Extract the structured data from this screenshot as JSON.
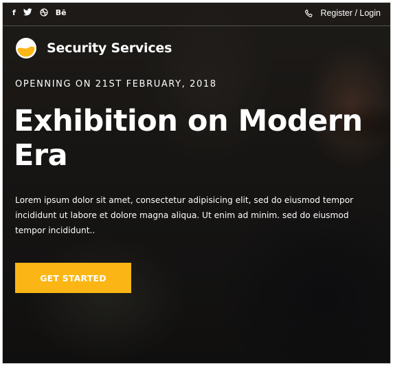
{
  "topbar": {
    "social": [
      {
        "icon": "facebook-icon",
        "label": "f"
      },
      {
        "icon": "twitter-icon",
        "label": ""
      },
      {
        "icon": "dribbble-icon",
        "label": ""
      },
      {
        "icon": "behance-icon",
        "label": "Bē"
      }
    ],
    "phone_icon": "phone-icon",
    "auth_label": "Register / Login"
  },
  "brand": {
    "name": "Security Services",
    "logo_colors": {
      "top": "#ffffff",
      "bottom": "#fbb615"
    }
  },
  "hero": {
    "eyebrow": "OPENNING ON 21ST FEBRUARY, 2018",
    "headline": "Exhibition on Modern Era",
    "body": "Lorem ipsum dolor sit amet, consectetur adipisicing elit, sed do eiusmod tempor incididunt ut labore et dolore magna aliqua. Ut enim ad minim. sed do eiusmod tempor incididunt..",
    "cta_label": "GET STARTED"
  },
  "colors": {
    "accent": "#fbb615",
    "text": "#ffffff"
  }
}
